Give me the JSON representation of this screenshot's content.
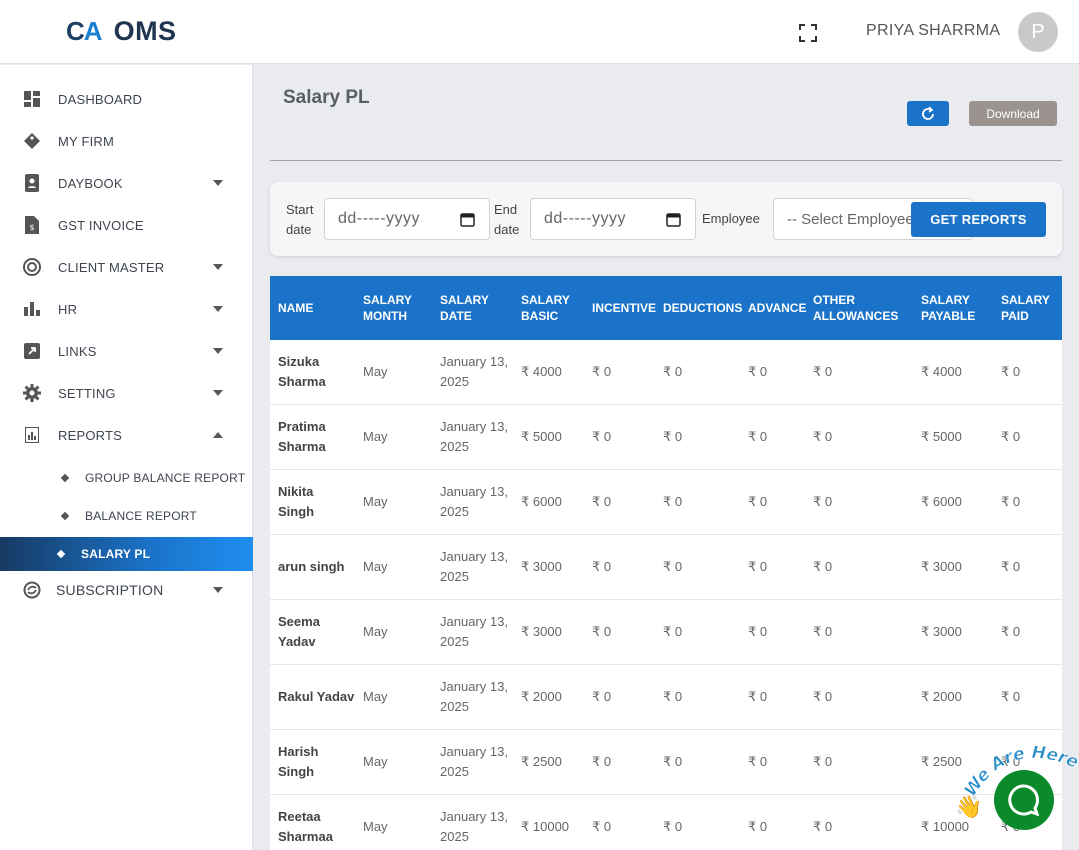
{
  "header": {
    "logo_mark_c": "C",
    "logo_mark_a": "A",
    "logo_text": "OMS",
    "username": "PRIYA SHARRMA",
    "avatar_initial": "P"
  },
  "sidebar": {
    "items": [
      {
        "label": "DASHBOARD",
        "icon": "dashboard-icon"
      },
      {
        "label": "MY FIRM",
        "icon": "diamond-tag-icon"
      },
      {
        "label": "DAYBOOK",
        "icon": "contact-book-icon"
      },
      {
        "label": "GST INVOICE",
        "icon": "invoice-icon"
      },
      {
        "label": "CLIENT MASTER",
        "icon": "client-icon"
      },
      {
        "label": "HR",
        "icon": "bar-chart-icon"
      },
      {
        "label": "LINKS",
        "icon": "external-link-icon"
      },
      {
        "label": "SETTING",
        "icon": "gear-icon"
      },
      {
        "label": "REPORTS",
        "icon": "report-icon"
      },
      {
        "label": "SUBSCRIPTION",
        "icon": "subscription-icon"
      }
    ],
    "sub_items": [
      {
        "label": "GROUP BALANCE REPORT"
      },
      {
        "label": "BALANCE REPORT"
      },
      {
        "label": "SALARY PL"
      }
    ]
  },
  "main": {
    "title": "Salary PL",
    "download_label": "Download",
    "filters": {
      "start_label_1": "Start",
      "start_label_2": "date",
      "start_value": "dd-----yyyy",
      "end_label_1": "End",
      "end_label_2": "date",
      "end_value": "dd-----yyyy",
      "employee_label": "Employee",
      "employee_placeholder": "-- Select Employee --",
      "get_reports_label": "GET REPORTS"
    }
  },
  "table": {
    "headers": [
      [
        "NAME"
      ],
      [
        "SALARY",
        "MONTH"
      ],
      [
        "SALARY",
        "DATE"
      ],
      [
        "SALARY",
        "BASIC"
      ],
      [
        "INCENTIVE"
      ],
      [
        "DEDUCTIONS"
      ],
      [
        "ADVANCE"
      ],
      [
        "OTHER",
        "ALLOWANCES"
      ],
      [
        "SALARY",
        "PAYABLE"
      ],
      [
        "SALARY",
        "PAID"
      ]
    ],
    "rows": [
      {
        "name": [
          "Sizuka",
          "Sharma"
        ],
        "month": "May",
        "date": [
          "January 13,",
          "2025"
        ],
        "basic": "₹ 4000",
        "incentive": "₹ 0",
        "deductions": "₹ 0",
        "advance": "₹ 0",
        "other": "₹ 0",
        "payable": "₹ 4000",
        "paid": "₹ 0"
      },
      {
        "name": [
          "Pratima",
          "Sharma"
        ],
        "month": "May",
        "date": [
          "January 13,",
          "2025"
        ],
        "basic": "₹ 5000",
        "incentive": "₹ 0",
        "deductions": "₹ 0",
        "advance": "₹ 0",
        "other": "₹ 0",
        "payable": "₹ 5000",
        "paid": "₹ 0"
      },
      {
        "name": [
          "Nikita",
          "Singh"
        ],
        "month": "May",
        "date": [
          "January 13,",
          "2025"
        ],
        "basic": "₹ 6000",
        "incentive": "₹ 0",
        "deductions": "₹ 0",
        "advance": "₹ 0",
        "other": "₹ 0",
        "payable": "₹ 6000",
        "paid": "₹ 0"
      },
      {
        "name": [
          "arun singh"
        ],
        "month": "May",
        "date": [
          "January 13,",
          "2025"
        ],
        "basic": "₹ 3000",
        "incentive": "₹ 0",
        "deductions": "₹ 0",
        "advance": "₹ 0",
        "other": "₹ 0",
        "payable": "₹ 3000",
        "paid": "₹ 0"
      },
      {
        "name": [
          "Seema",
          "Yadav"
        ],
        "month": "May",
        "date": [
          "January 13,",
          "2025"
        ],
        "basic": "₹ 3000",
        "incentive": "₹ 0",
        "deductions": "₹ 0",
        "advance": "₹ 0",
        "other": "₹ 0",
        "payable": "₹ 3000",
        "paid": "₹ 0"
      },
      {
        "name": [
          "Rakul Yadav"
        ],
        "month": "May",
        "date": [
          "January 13,",
          "2025"
        ],
        "basic": "₹ 2000",
        "incentive": "₹ 0",
        "deductions": "₹ 0",
        "advance": "₹ 0",
        "other": "₹ 0",
        "payable": "₹ 2000",
        "paid": "₹ 0"
      },
      {
        "name": [
          "Harish",
          "Singh"
        ],
        "month": "May",
        "date": [
          "January 13,",
          "2025"
        ],
        "basic": "₹ 2500",
        "incentive": "₹ 0",
        "deductions": "₹ 0",
        "advance": "₹ 0",
        "other": "₹ 0",
        "payable": "₹ 2500",
        "paid": "₹ 0"
      },
      {
        "name": [
          "Reetaa",
          "Sharmaa"
        ],
        "month": "May",
        "date": [
          "January 13,",
          "2025"
        ],
        "basic": "₹ 10000",
        "incentive": "₹ 0",
        "deductions": "₹ 0",
        "advance": "₹ 0",
        "other": "₹ 0",
        "payable": "₹ 10000",
        "paid": "₹ 0"
      }
    ]
  },
  "chat": {
    "badge_text": "We Are Here!"
  },
  "colors": {
    "primary": "#1a73c9",
    "chat_green": "#0b8a2a",
    "download_gray": "#9a9390"
  }
}
